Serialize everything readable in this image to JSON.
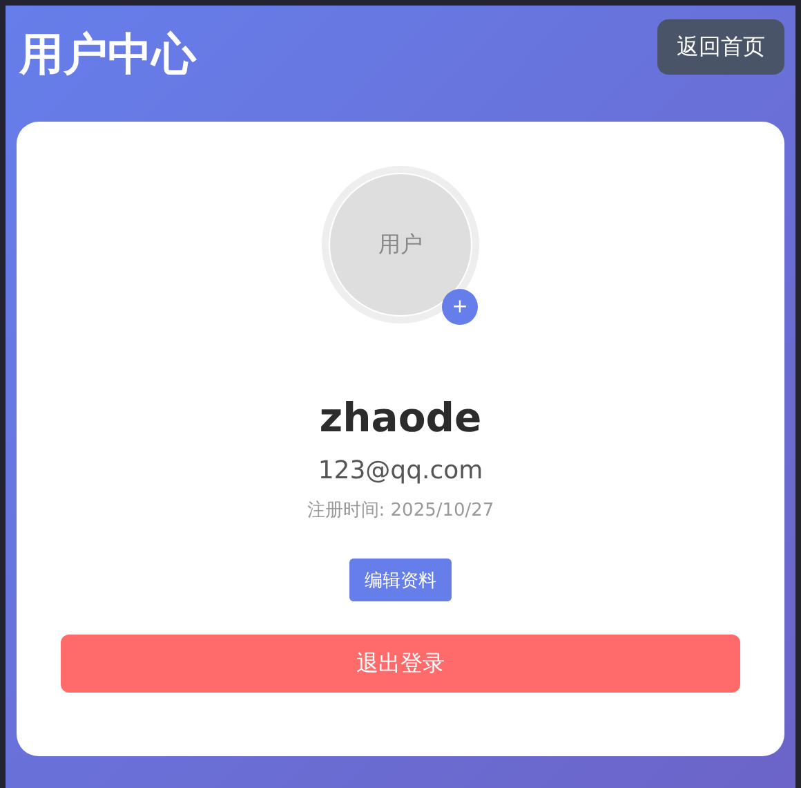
{
  "header": {
    "title": "用户中心",
    "back_button": "返回首页"
  },
  "profile": {
    "avatar_text": "用户",
    "avatar_add": "+",
    "username": "zhaode",
    "email": "123@qq.com",
    "registered": "注册时间: 2025/10/27",
    "edit_button": "编辑资料",
    "logout_button": "退出登录"
  }
}
